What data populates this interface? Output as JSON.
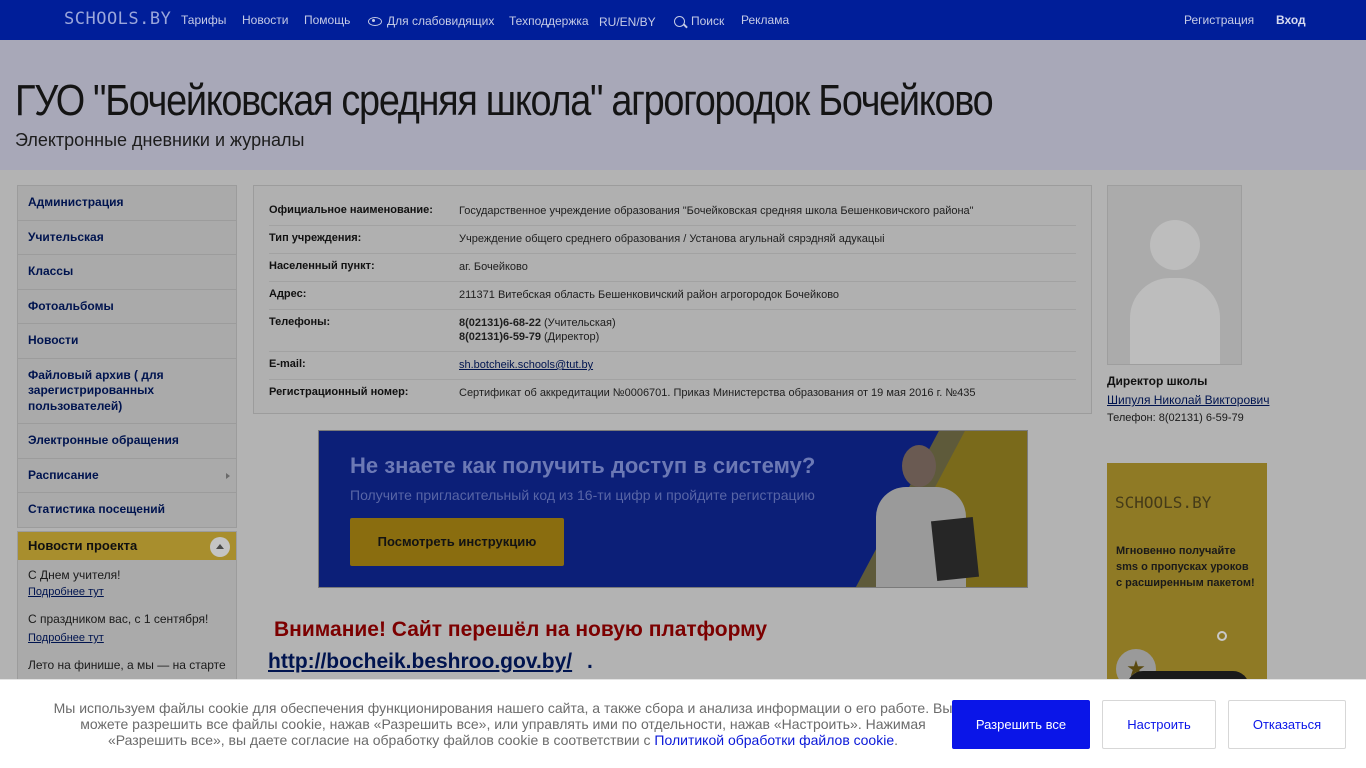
{
  "topnav": {
    "logo": "SCHOOLS.BY",
    "items": [
      {
        "label": "Тарифы"
      },
      {
        "label": "Новости"
      },
      {
        "label": "Помощь"
      },
      {
        "label": "Для слабовидящих",
        "icon": "eye-icon"
      },
      {
        "label": "Техподдержка"
      },
      {
        "label": "RU/EN/BY"
      },
      {
        "label": "Поиск",
        "icon": "search-icon"
      },
      {
        "label": "Реклама"
      }
    ],
    "register": "Регистрация",
    "login": "Вход"
  },
  "header": {
    "title": "ГУО \"Бочейковская средняя школа\" агрогородок Бочейково",
    "subtitle": "Электронные дневники и журналы"
  },
  "sidebar": {
    "items": [
      {
        "label": "Администрация"
      },
      {
        "label": "Учительская"
      },
      {
        "label": "Классы"
      },
      {
        "label": "Фотоальбомы"
      },
      {
        "label": "Новости"
      },
      {
        "label": "Файловый архив ( для зарегистрированных пользователей)"
      },
      {
        "label": "Электронные обращения"
      },
      {
        "label": "Расписание"
      },
      {
        "label": "Статистика посещений"
      }
    ]
  },
  "project_news": {
    "title": "Новости проекта",
    "entries": [
      {
        "text": "С Днем учителя!",
        "more": "Подробнее тут"
      },
      {
        "text": "С праздником вас, с 1 сентября!",
        "more": "Подробнее тут"
      },
      {
        "text": "Лето на финише, а мы — на старте",
        "more": ""
      }
    ]
  },
  "school_info": {
    "rows": [
      {
        "key": "Официальное наименование:",
        "value": "Государственное учреждение образования \"Бочейковская средняя школа Бешенковичского района\""
      },
      {
        "key": "Тип учреждения:",
        "value": "Учреждение общего среднего образования / Установа агульнай сярэдняй адукацыі"
      },
      {
        "key": "Населенный пункт:",
        "value": "аг. Бочейково"
      },
      {
        "key": "Адрес:",
        "value": "211371 Витебская область Бешенковичский район агрогородок Бочейково"
      },
      {
        "key": "Телефоны:",
        "phone1": "8(02131)6-68-22",
        "phone1_note": "(Учительская)",
        "phone2": "8(02131)6-59-79",
        "phone2_note": "(Директор)"
      },
      {
        "key": "E-mail:",
        "value": "sh.botcheik.schools@tut.by"
      },
      {
        "key": "Регистрационный номер:",
        "value": "Сертификат об аккредитации №0006701. Приказ Министерства образования от 19 мая 2016 г. №435"
      }
    ]
  },
  "banner": {
    "headline": "Не знаете как получить доступ в систему?",
    "subline": "Получите пригласительный код из 16-ти цифр и пройдите регистрацию",
    "button": "Посмотреть инструкцию"
  },
  "notice": {
    "text": "Внимание! Сайт перешёл на новую платформу",
    "link": "http://bocheik.beshroo.gov.by/",
    "tail": "."
  },
  "director": {
    "label": "Директор школы",
    "name": "Шипуля Николай Викторович",
    "phone": "Телефон: 8(02131) 6-59-79"
  },
  "ad": {
    "brand": "SCHOOLS.BY",
    "text": "Мгновенно получайте sms о пропусках уроков с расширенным пакетом!"
  },
  "cookie": {
    "text": "Мы используем файлы cookie для обеспечения функционирования нашего сайта, а также сбора и анализа информации о его работе. Вы можете разрешить все файлы cookie, нажав «Разрешить все», или управлять ими по отдельности, нажав «Настроить». Нажимая «Разрешить все», вы даете согласие на обработку файлов cookie в соответствии с",
    "link": "Политикой обработки файлов cookie",
    "tail": ".",
    "allow": "Разрешить все",
    "setup": "Настроить",
    "deny": "Отказаться"
  },
  "colors": {
    "topbar": "#001e99",
    "accent_button": "#0a15e8",
    "alert_red": "#7c0000"
  }
}
